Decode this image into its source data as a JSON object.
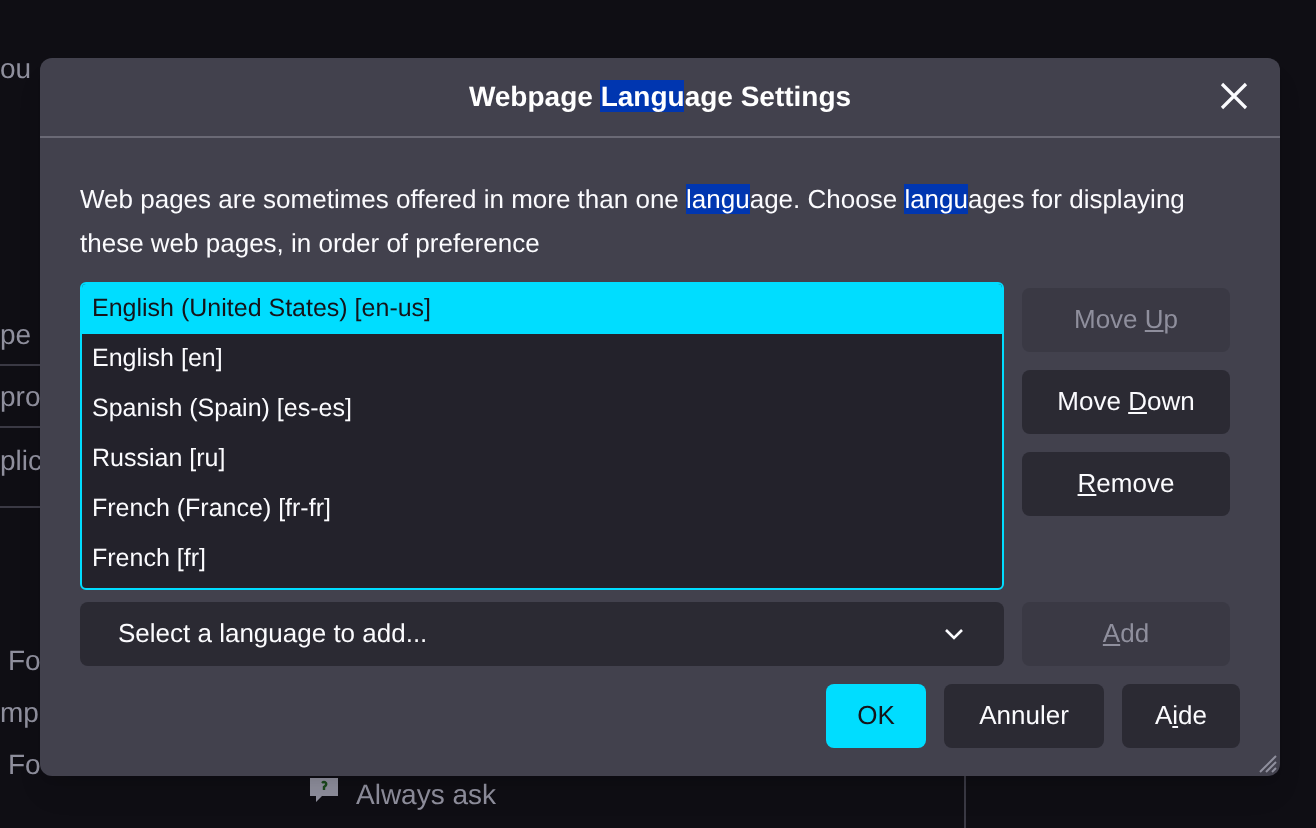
{
  "background_page": {
    "fragments": [
      "ou",
      "pe",
      "pro",
      "plic",
      "Fo",
      "mp",
      "Fo"
    ],
    "always_ask": "Always ask"
  },
  "dialog": {
    "title": [
      {
        "text": "Webpage ",
        "highlighted": false
      },
      {
        "text": "Langu",
        "highlighted": true
      },
      {
        "text": "age Settings",
        "highlighted": false
      }
    ],
    "description": [
      {
        "text": "Web pages are sometimes offered in more than one ",
        "highlighted": false
      },
      {
        "text": "langu",
        "highlighted": true
      },
      {
        "text": "age. Choose ",
        "highlighted": false
      },
      {
        "text": "langu",
        "highlighted": true
      },
      {
        "text": "ages for displaying these web pages, in order of preference",
        "highlighted": false
      }
    ],
    "languages": [
      {
        "label": "English (United States) [en-us]",
        "selected": true
      },
      {
        "label": "English [en]",
        "selected": false
      },
      {
        "label": "Spanish (Spain) [es-es]",
        "selected": false
      },
      {
        "label": "Russian [ru]",
        "selected": false
      },
      {
        "label": "French (France) [fr-fr]",
        "selected": false
      },
      {
        "label": "French [fr]",
        "selected": false
      }
    ],
    "side_buttons": [
      {
        "label_parts": [
          {
            "text": "Move ",
            "underlined": false
          },
          {
            "text": "U",
            "underlined": true
          },
          {
            "text": "p",
            "underlined": false
          }
        ],
        "disabled": true
      },
      {
        "label_parts": [
          {
            "text": "Move ",
            "underlined": false
          },
          {
            "text": "D",
            "underlined": true
          },
          {
            "text": "own",
            "underlined": false
          }
        ],
        "disabled": false
      },
      {
        "label_parts": [
          {
            "text": "R",
            "underlined": true
          },
          {
            "text": "emove",
            "underlined": false
          }
        ],
        "disabled": false
      }
    ],
    "dropdown": {
      "value": "Select a language to add..."
    },
    "add_button": {
      "label_parts": [
        {
          "text": "A",
          "underlined": true
        },
        {
          "text": "dd",
          "underlined": false
        }
      ],
      "disabled": true
    },
    "footer_buttons": [
      {
        "label": "OK",
        "primary": true
      },
      {
        "label": "Annuler",
        "primary": false
      },
      {
        "label_parts": [
          {
            "text": "A",
            "underlined": false
          },
          {
            "text": "i",
            "underlined": true
          },
          {
            "text": "de",
            "underlined": false
          }
        ],
        "primary": false
      }
    ]
  }
}
